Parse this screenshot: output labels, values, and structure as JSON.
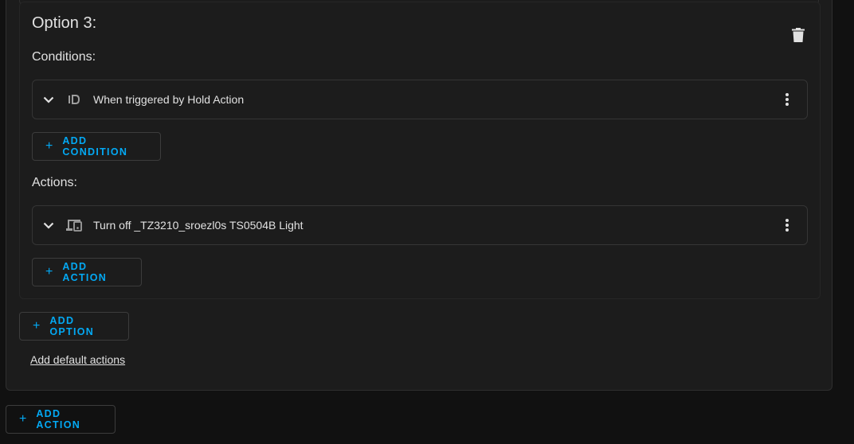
{
  "option": {
    "title": "Option 3:",
    "conditions_label": "Conditions:",
    "actions_label": "Actions:"
  },
  "conditions": [
    {
      "icon": "id-icon",
      "text": "When triggered by Hold Action"
    }
  ],
  "actions": [
    {
      "icon": "devices-icon",
      "text": "Turn off _TZ3210_sroezl0s TS0504B Light"
    }
  ],
  "buttons": {
    "add_condition": "ADD CONDITION",
    "add_action_inner": "ADD ACTION",
    "add_option": "ADD OPTION",
    "add_action_outer": "ADD ACTION",
    "plus": "+"
  },
  "links": {
    "add_default_actions": "Add default actions"
  },
  "colors": {
    "accent": "#03a9f4",
    "background": "#111111",
    "card": "#1c1c1c",
    "text": "#e1e1e1"
  }
}
